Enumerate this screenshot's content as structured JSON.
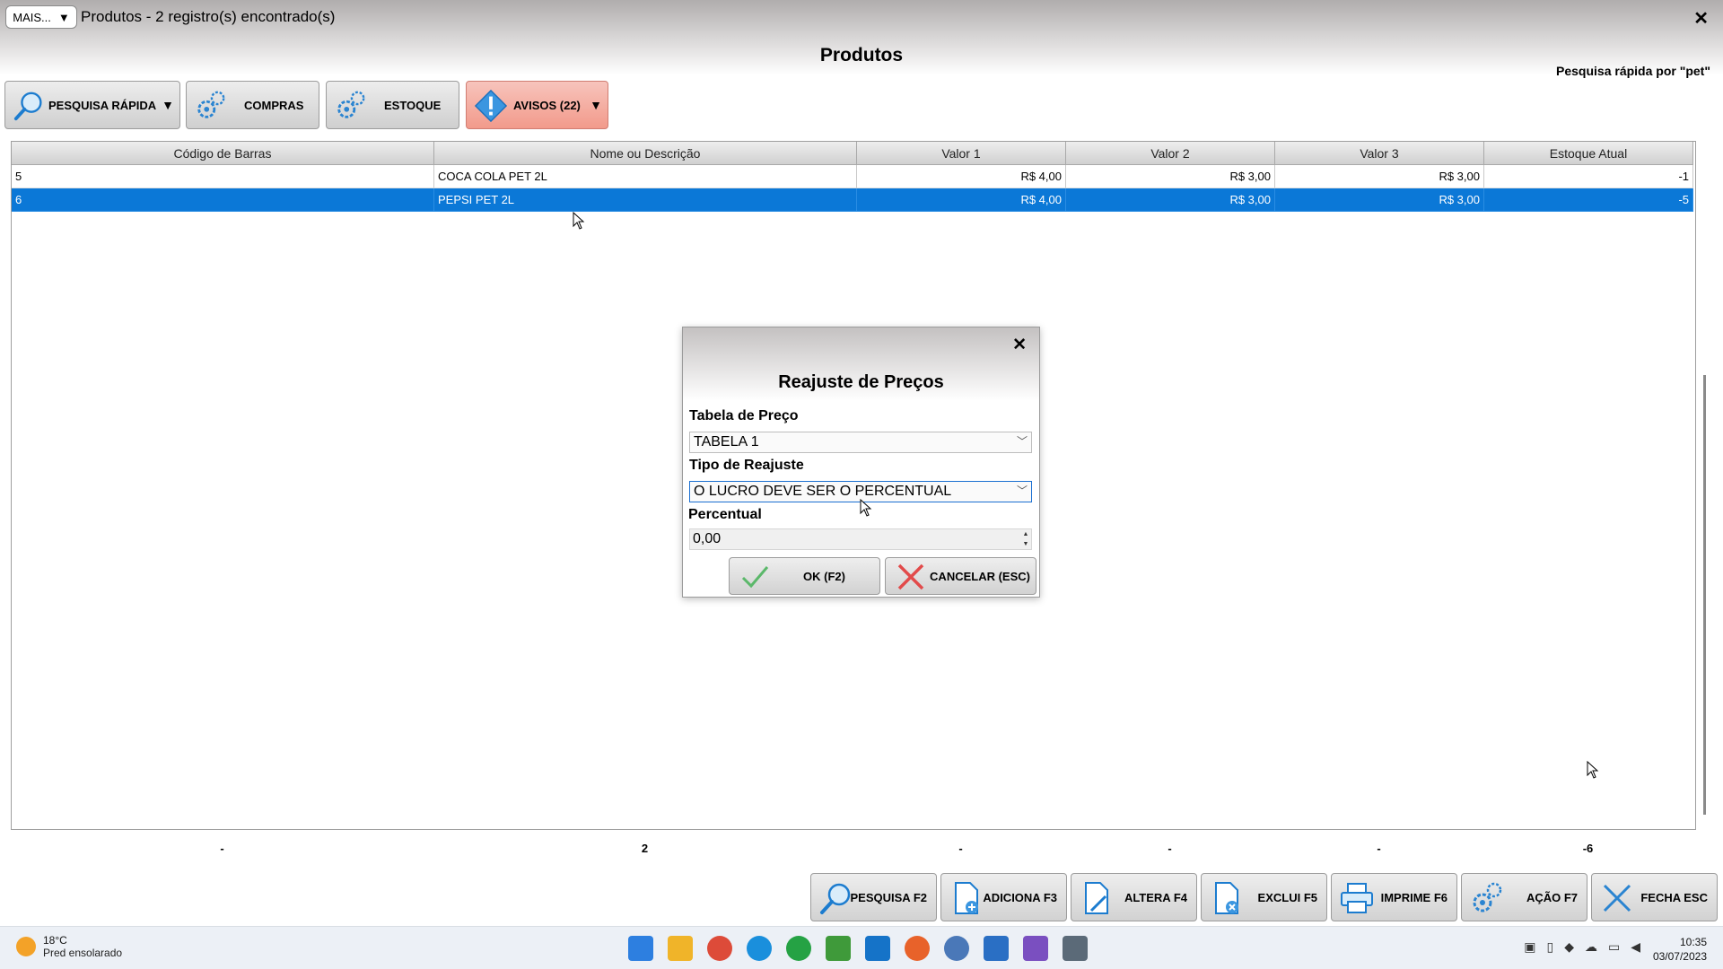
{
  "window": {
    "mais_label": "MAIS...",
    "mais_caret": "▼",
    "title": "Produtos - 2 registro(s) encontrado(s)",
    "close": "✕"
  },
  "header": {
    "page_title": "Produtos",
    "quick_search_note": "Pesquisa rápida por \"pet\""
  },
  "toolbar": {
    "pesquisa_label": "PESQUISA RÁPIDA",
    "compras_label": "COMPRAS",
    "estoque_label": "ESTOQUE",
    "avisos_label": "AVISOS (22)",
    "dropdown_caret": "▼"
  },
  "table": {
    "columns": [
      "Código de Barras",
      "Nome ou Descrição",
      "Valor 1",
      "Valor 2",
      "Valor 3",
      "Estoque Atual"
    ],
    "rows": [
      {
        "codigo": "5",
        "nome": "COCA COLA PET 2L",
        "v1": "R$ 4,00",
        "v2": "R$ 3,00",
        "v3": "R$ 3,00",
        "estoque": "-1"
      },
      {
        "codigo": "6",
        "nome": "PEPSI PET 2L",
        "v1": "R$ 4,00",
        "v2": "R$ 3,00",
        "v3": "R$ 3,00",
        "estoque": "-5"
      }
    ],
    "selected_row": 1
  },
  "totals": [
    "-",
    "2",
    "-",
    "-",
    "-",
    "-6"
  ],
  "bottom_buttons": {
    "pesquisa": "PESQUISA F2",
    "adiciona": "ADICIONA F3",
    "altera": "ALTERA F4",
    "exclui": "EXCLUI F5",
    "imprime": "IMPRIME F6",
    "acao": "AÇÃO F7",
    "fecha": "FECHA ESC"
  },
  "dialog": {
    "title": "Reajuste de Preços",
    "close": "✕",
    "tabela_label": "Tabela de Preço",
    "tabela_value": "TABELA 1",
    "tipo_label": "Tipo de Reajuste",
    "tipo_value": "O LUCRO DEVE SER O PERCENTUAL",
    "percentual_label": "Percentual",
    "percentual_value": "0,00",
    "ok_label": "OK (F2)",
    "cancel_label": "CANCELAR (ESC)"
  },
  "taskbar": {
    "temperature": "18°C",
    "weather": "Pred ensolarado",
    "time": "10:35",
    "date": "03/07/2023"
  },
  "colors": {
    "selection": "#0b78d7",
    "warning_button": "#f29a8b",
    "focus_border": "#1a6fd1"
  }
}
